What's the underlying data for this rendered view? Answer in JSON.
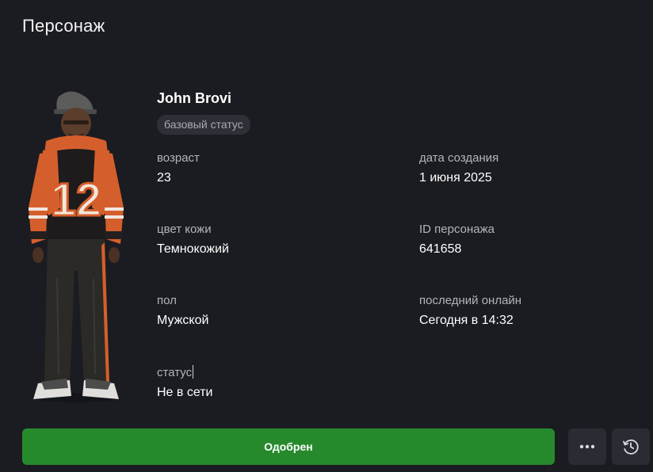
{
  "panel": {
    "title": "Персонаж"
  },
  "character": {
    "name": "John Brovi",
    "status_badge": "базовый статус",
    "avatar_icon": "character-skin-icon",
    "jersey_number": "12"
  },
  "fields": {
    "age": {
      "label": "возраст",
      "value": "23"
    },
    "created": {
      "label": "дата создания",
      "value": "1 июня 2025"
    },
    "skin": {
      "label": "цвет кожи",
      "value": "Темнокожий"
    },
    "id": {
      "label": "ID персонажа",
      "value": "641658"
    },
    "gender": {
      "label": "пол",
      "value": "Мужской"
    },
    "last_online": {
      "label": "последний онлайн",
      "value": "Сегодня в 14:32"
    },
    "status": {
      "label": "статус",
      "value": "Не в сети"
    }
  },
  "actions": {
    "approve_label": "Одобрен",
    "approve_color": "#268a2d",
    "more_icon": "more-horizontal-icon",
    "history_icon": "history-clock-icon"
  },
  "colors": {
    "background": "#1b1c21",
    "chip_background": "#2e3038",
    "icon_button_background": "#2a2c34"
  }
}
